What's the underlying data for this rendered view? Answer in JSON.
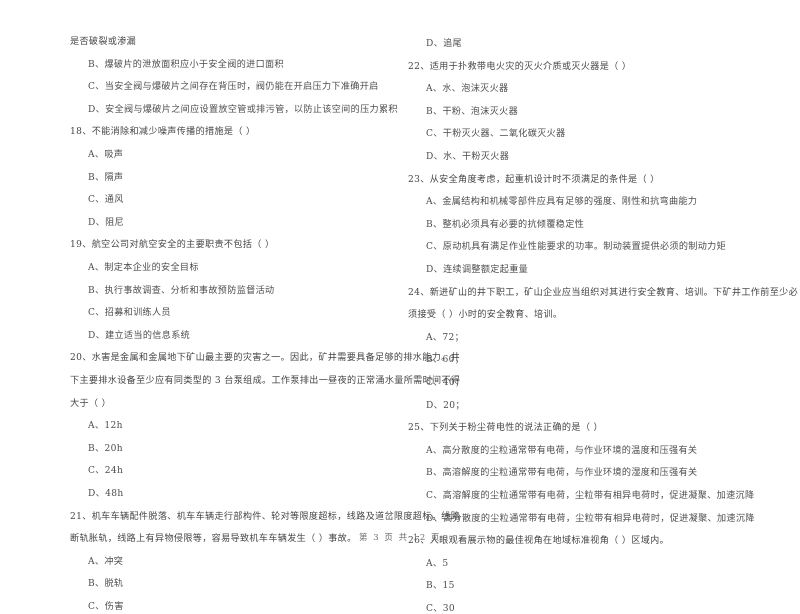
{
  "document": {
    "type": "exam-paper",
    "language": "zh-CN",
    "footer": "第 3 页 共 12 页"
  },
  "left_column": {
    "continuation_text": "是否破裂或渗漏",
    "items": [
      {
        "kind": "option",
        "text": "B、爆破片的泄放面积应小于安全阀的进口面积"
      },
      {
        "kind": "option",
        "text": "C、当安全阀与爆破片之间存在背压时，阀仍能在开启压力下准确开启"
      },
      {
        "kind": "option",
        "text": "D、安全阀与爆破片之间应设置放空管或排污管，以防止该空间的压力累积"
      },
      {
        "kind": "question",
        "text": "18、不能消除和减少噪声传播的措施是（      ）"
      },
      {
        "kind": "option",
        "text": "A、吸声"
      },
      {
        "kind": "option",
        "text": "B、隔声"
      },
      {
        "kind": "option",
        "text": "C、通风"
      },
      {
        "kind": "option",
        "text": "D、阻尼"
      },
      {
        "kind": "question",
        "text": "19、航空公司对航空安全的主要职责不包括（      ）"
      },
      {
        "kind": "option",
        "text": "A、制定本企业的安全目标"
      },
      {
        "kind": "option",
        "text": "B、执行事故调查、分析和事故预防监督活动"
      },
      {
        "kind": "option",
        "text": "C、招募和训练人员"
      },
      {
        "kind": "option",
        "text": "D、建立适当的信息系统"
      },
      {
        "kind": "question-wide",
        "text": "20、水害是金属和金属地下矿山最主要的灾害之一。因此，矿井需要具备足够的排水能力。井"
      },
      {
        "kind": "question-wide",
        "text": "下主要排水设备至少应有同类型的 3 台泵组成。工作泵排出一昼夜的正常涌水量所需时间不得"
      },
      {
        "kind": "question-cont",
        "text": "大于（      ）"
      },
      {
        "kind": "option",
        "text": "A、12h"
      },
      {
        "kind": "option",
        "text": "B、20h"
      },
      {
        "kind": "option",
        "text": "C、24h"
      },
      {
        "kind": "option",
        "text": "D、48h"
      },
      {
        "kind": "question-wide",
        "text": "21、机车车辆配件脱落、机车车辆走行部构件、轮对等限度超标，线路及道岔限度超标，线路"
      },
      {
        "kind": "question-wide",
        "text": "断轨胀轨，线路上有异物侵限等，容易导致机车车辆发生（      ）事故。"
      },
      {
        "kind": "option",
        "text": "A、冲突"
      },
      {
        "kind": "option",
        "text": "B、脱轨"
      },
      {
        "kind": "option",
        "text": "C、伤害"
      }
    ]
  },
  "right_column": {
    "items": [
      {
        "kind": "option",
        "text": "D、追尾"
      },
      {
        "kind": "question",
        "text": "22、适用于扑救带电火灾的灭火介质或灭火器是（      ）"
      },
      {
        "kind": "option",
        "text": "A、水、泡沫灭火器"
      },
      {
        "kind": "option",
        "text": "B、干粉、泡沫灭火器"
      },
      {
        "kind": "option",
        "text": "C、干粉灭火器、二氧化碳灭火器"
      },
      {
        "kind": "option",
        "text": "D、水、干粉灭火器"
      },
      {
        "kind": "question",
        "text": "23、从安全角度考虑，起重机设计时不须满足的条件是（      ）"
      },
      {
        "kind": "option",
        "text": "A、金属结构和机械零部件应具有足够的强度、刚性和抗弯曲能力"
      },
      {
        "kind": "option",
        "text": "B、整机必须具有必要的抗倾覆稳定性"
      },
      {
        "kind": "option",
        "text": "C、原动机具有满足作业性能要求的功率。制动装置提供必须的制动力矩"
      },
      {
        "kind": "option",
        "text": "D、连续调整额定起重量"
      },
      {
        "kind": "question-wide",
        "text": "24、新进矿山的井下职工，矿山企业应当组织对其进行安全教育、培训。下矿井工作前至少必"
      },
      {
        "kind": "question-cont",
        "text": "须接受（      ）小时的安全教育、培训。"
      },
      {
        "kind": "option",
        "text": "A、72；"
      },
      {
        "kind": "option",
        "text": "B、60；"
      },
      {
        "kind": "option",
        "text": "C、40；"
      },
      {
        "kind": "option",
        "text": "D、20；"
      },
      {
        "kind": "question",
        "text": "25、下列关于粉尘荷电性的说法正确的是（      ）"
      },
      {
        "kind": "option",
        "text": "A、高分散度的尘粒通常带有电荷，与作业环境的温度和压强有关"
      },
      {
        "kind": "option",
        "text": "B、高溶解度的尘粒通常带有电荷，与作业环境的湿度和压强有关"
      },
      {
        "kind": "option",
        "text": "C、高溶解度的尘粒通常带有电荷，尘粒带有相异电荷时，促进凝聚、加速沉降"
      },
      {
        "kind": "option",
        "text": "D、高分散度的尘粒通常带有电荷，尘粒带有相异电荷时，促进凝聚、加速沉降"
      },
      {
        "kind": "question",
        "text": "26、人眼观看展示物的最佳视角在地域标准视角（      ）区域内。"
      },
      {
        "kind": "option",
        "text": "A、5"
      },
      {
        "kind": "option",
        "text": "B、15"
      },
      {
        "kind": "option",
        "text": "C、30"
      }
    ]
  }
}
